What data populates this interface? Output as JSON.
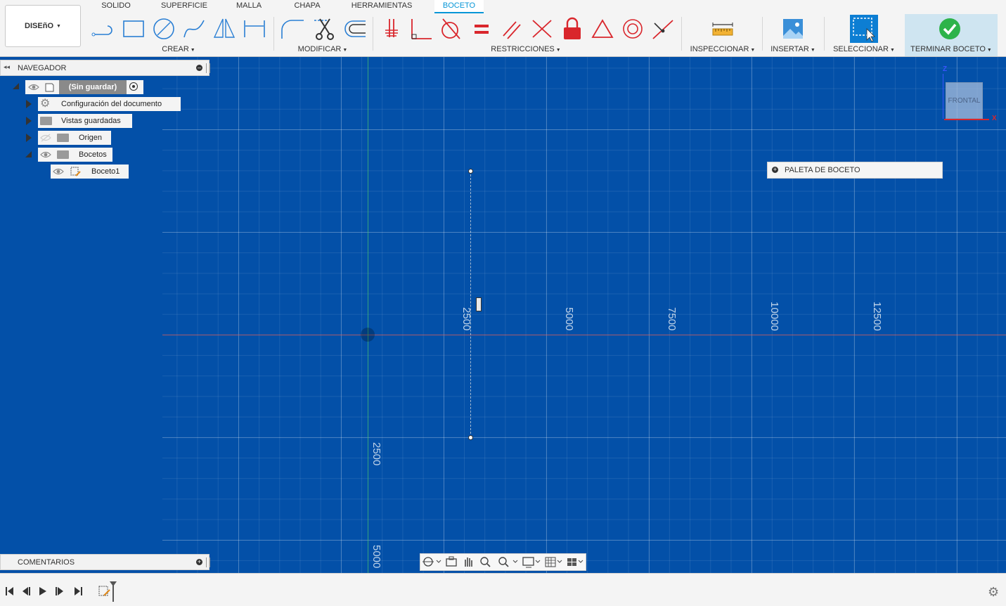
{
  "workspace": {
    "label": "DISEñO"
  },
  "tabs": [
    {
      "label": "SOLIDO"
    },
    {
      "label": "SUPERFICIE"
    },
    {
      "label": "MALLA"
    },
    {
      "label": "CHAPA"
    },
    {
      "label": "HERRAMIENTAS"
    },
    {
      "label": "BOCETO",
      "active": true
    }
  ],
  "groups": {
    "crear": "CREAR",
    "modificar": "MODIFICAR",
    "restricciones": "RESTRICCIONES",
    "inspeccionar": "INSPECCIONAR",
    "insertar": "INSERTAR",
    "seleccionar": "SELECCIONAR",
    "terminar": "TERMINAR BOCETO"
  },
  "navigator": {
    "title": "NAVEGADOR",
    "root": "(Sin guardar)",
    "items": [
      {
        "label": "Configuración del documento"
      },
      {
        "label": "Vistas guardadas"
      },
      {
        "label": "Origen"
      },
      {
        "label": "Bocetos"
      }
    ],
    "child": "Boceto1"
  },
  "viewcube": {
    "face": "FRONTAL",
    "z": "Z",
    "x": "X"
  },
  "palette": {
    "label": "PALETA DE BOCETO"
  },
  "axis_labels": {
    "h": [
      "2500",
      "5000",
      "7500",
      "10000",
      "12500"
    ],
    "v": [
      "2500",
      "5000"
    ]
  },
  "comments": {
    "label": "COMENTARIOS"
  },
  "colors": {
    "accent": "#0696d7",
    "canvas": "#0350a8",
    "constraint_red": "#d9262c",
    "finish_green": "#2db34a"
  },
  "icons": [
    "line-icon",
    "rectangle-icon",
    "circle-icon",
    "spline-icon",
    "mirror-icon",
    "dimension-icon",
    "fillet-icon",
    "trim-icon",
    "offset-icon",
    "fix-icon",
    "perpendicular-icon",
    "tangent-icon",
    "equal-icon",
    "parallel-icon",
    "midpoint-icon",
    "lock-icon",
    "triangle-icon",
    "concentric-icon",
    "coincident-icon",
    "measure-icon",
    "image-icon",
    "select-icon",
    "checkmark-icon"
  ]
}
